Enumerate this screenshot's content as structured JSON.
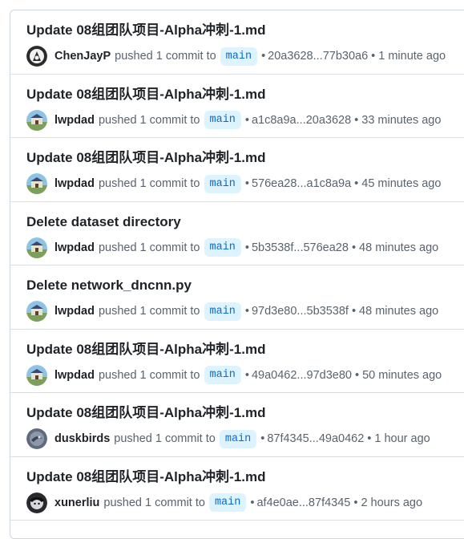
{
  "activity": {
    "items": [
      {
        "title": "Update 08组团队项目-Alpha冲刺-1.md",
        "user": "ChenJayP",
        "action": "pushed 1 commit to",
        "branch": "main",
        "sep": "•",
        "range": "20a3628...77b30a6",
        "time": "• 1 minute ago",
        "avatar_icon": "dark-avatar-icon"
      },
      {
        "title": "Update 08组团队项目-Alpha冲刺-1.md",
        "user": "lwpdad",
        "action": "pushed 1 commit to",
        "branch": "main",
        "sep": "•",
        "range": "a1c8a9a...20a3628",
        "time": "• 33 minutes ago",
        "avatar_icon": "sky-avatar-icon"
      },
      {
        "title": "Update 08组团队项目-Alpha冲刺-1.md",
        "user": "lwpdad",
        "action": "pushed 1 commit to",
        "branch": "main",
        "sep": "•",
        "range": "576ea28...a1c8a9a",
        "time": "• 45 minutes ago",
        "avatar_icon": "sky-avatar-icon"
      },
      {
        "title": "Delete dataset directory",
        "user": "lwpdad",
        "action": "pushed 1 commit to",
        "branch": "main",
        "sep": "•",
        "range": "5b3538f...576ea28",
        "time": "• 48 minutes ago",
        "avatar_icon": "sky-avatar-icon"
      },
      {
        "title": "Delete network_dncnn.py",
        "user": "lwpdad",
        "action": "pushed 1 commit to",
        "branch": "main",
        "sep": "•",
        "range": "97d3e80...5b3538f",
        "time": "• 48 minutes ago",
        "avatar_icon": "sky-avatar-icon"
      },
      {
        "title": "Update 08组团队项目-Alpha冲刺-1.md",
        "user": "lwpdad",
        "action": "pushed 1 commit to",
        "branch": "main",
        "sep": "•",
        "range": "49a0462...97d3e80",
        "time": "• 50 minutes ago",
        "avatar_icon": "sky-avatar-icon"
      },
      {
        "title": "Update 08组团队项目-Alpha冲刺-1.md",
        "user": "duskbirds",
        "action": "pushed 1 commit to",
        "branch": "main",
        "sep": "•",
        "range": "87f4345...49a0462",
        "time": "• 1 hour ago",
        "avatar_icon": "bird-avatar-icon"
      },
      {
        "title": "Update 08组团队项目-Alpha冲刺-1.md",
        "user": "xunerliu",
        "action": "pushed 1 commit to",
        "branch": "main",
        "sep": "•",
        "range": "af4e0ae...87f4345",
        "time": "• 2 hours ago",
        "avatar_icon": "anime-avatar-icon"
      }
    ]
  }
}
